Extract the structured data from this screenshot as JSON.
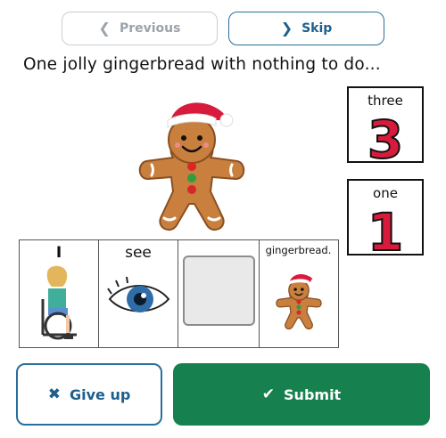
{
  "nav": {
    "previous_label": "Previous",
    "skip_label": "Skip",
    "previous_icon": "chevron-left-icon",
    "skip_icon": "chevron-right-icon"
  },
  "sentence": {
    "title": "One jolly gingerbread with nothing to do..."
  },
  "number_cards": [
    {
      "word": "three",
      "numeral": "3"
    },
    {
      "word": "one",
      "numeral": "1"
    }
  ],
  "sentence_strip": {
    "cells": [
      {
        "word": "I",
        "picture": "child-in-wheelchair"
      },
      {
        "word": "see",
        "picture": "eye"
      },
      {
        "word": "",
        "picture": "empty-slot"
      },
      {
        "word": "gingerbread.",
        "picture": "gingerbread-man"
      }
    ]
  },
  "actions": {
    "give_up_label": "Give up",
    "submit_label": "Submit",
    "give_up_icon": "x-icon",
    "submit_icon": "check-icon"
  },
  "colors": {
    "primary_blue": "#1e5f8c",
    "submit_green": "#16804e",
    "numeral_red": "#d81b3c"
  }
}
